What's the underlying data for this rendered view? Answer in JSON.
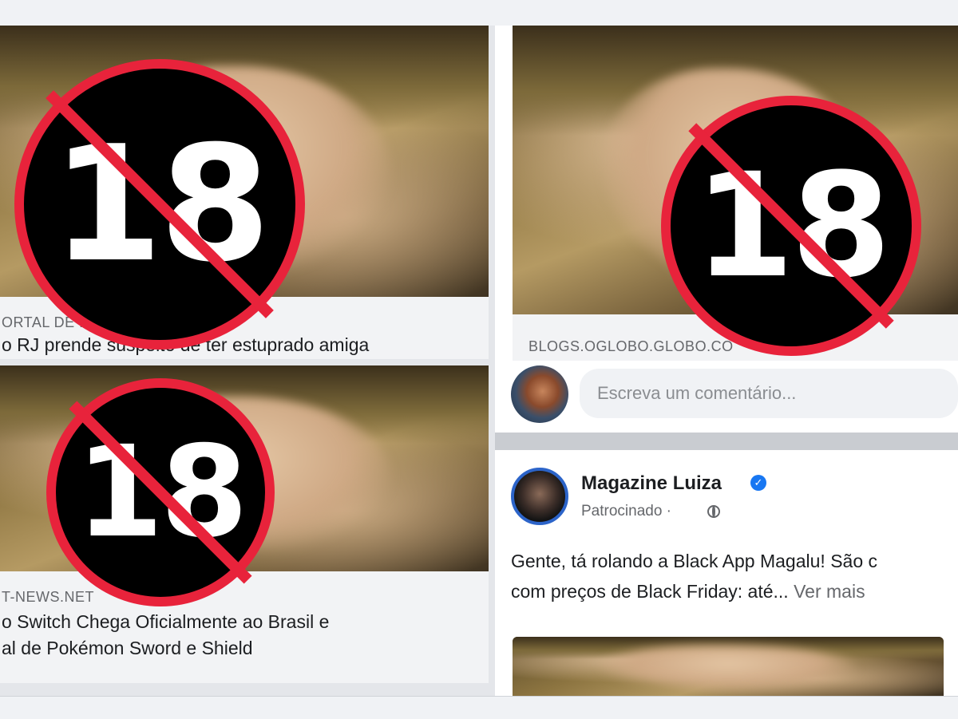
{
  "badge_text": "18",
  "left_posts": [
    {
      "domain": "ORTAL DE F",
      "headline": "o RJ prende suspeito de ter estuprado amiga"
    },
    {
      "domain": "T-NEWS.NET",
      "headline_lines": [
        "o Switch Chega Oficialmente ao Brasil e",
        "al de Pokémon Sword e Shield"
      ]
    }
  ],
  "right_top_post": {
    "domain": "BLOGS.OGLOBO.GLOBO.CO"
  },
  "comment": {
    "placeholder": "Escreva um comentário..."
  },
  "sponsored_post": {
    "page_name": "Magazine Luiza",
    "meta": "Patrocinado ·",
    "text_line1": "Gente, tá rolando a Black App Magalu! São c",
    "text_line2": "com preços de Black Friday: até...",
    "see_more": "Ver mais"
  },
  "colors": {
    "badge_red": "#e8233b",
    "badge_black": "#000000",
    "facebook_blue": "#1877f2",
    "text_secondary": "#65676b"
  },
  "icons": [
    "verified-badge-icon",
    "globe-icon",
    "age-restriction-18-icon"
  ]
}
